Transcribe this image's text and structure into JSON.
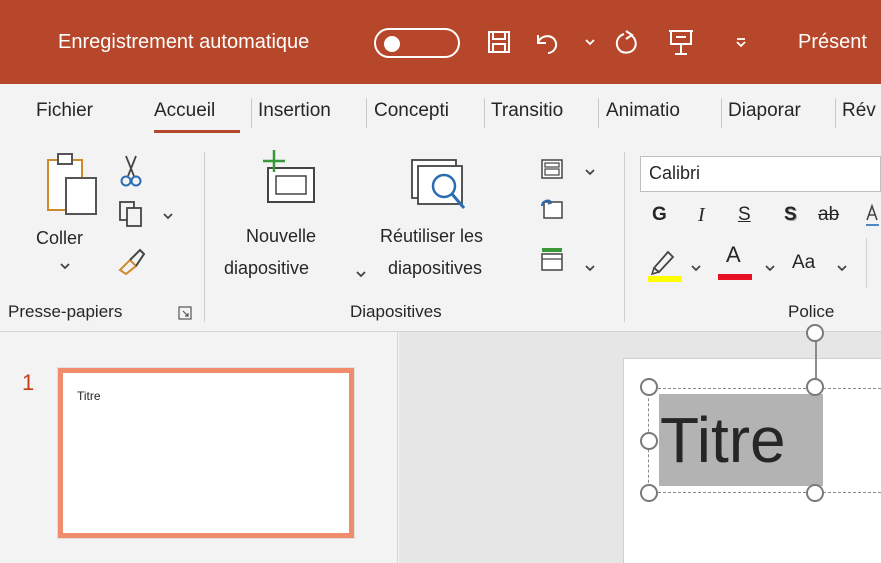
{
  "titlebar": {
    "autosave_label": "Enregistrement automatique",
    "app_label": "Présent",
    "bg_color": "#b7472a"
  },
  "tabs": [
    {
      "label": "Fichier"
    },
    {
      "label": "Accueil",
      "active": true
    },
    {
      "label": "Insertion"
    },
    {
      "label": "Concepti"
    },
    {
      "label": "Transitio"
    },
    {
      "label": "Animatio"
    },
    {
      "label": "Diaporar"
    },
    {
      "label": "Rév"
    }
  ],
  "ribbon": {
    "clipboard": {
      "paste_label": "Coller",
      "group_label": "Presse-papiers"
    },
    "slides": {
      "new_slide_line1": "Nouvelle",
      "new_slide_line2": "diapositive",
      "reuse_line1": "Réutiliser les",
      "reuse_line2": "diapositives",
      "group_label": "Diapositives"
    },
    "font": {
      "font_name": "Calibri",
      "bold": "G",
      "italic": "I",
      "underline": "S",
      "shadow": "S",
      "strike": "ab",
      "change_case": "Aa",
      "font_color_letter": "A",
      "group_label": "Police",
      "highlight_color": "#ffff00",
      "font_color": "#e81123"
    }
  },
  "thumbnails": [
    {
      "number": "1",
      "title": "Titre"
    }
  ],
  "slide": {
    "title": "Titre"
  }
}
